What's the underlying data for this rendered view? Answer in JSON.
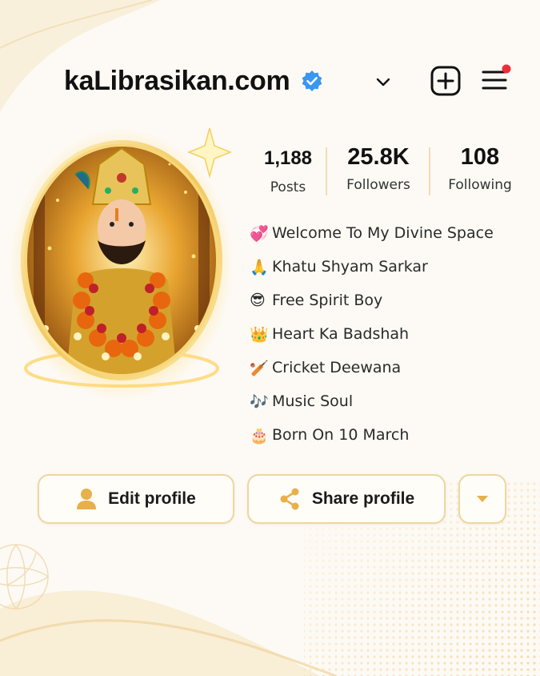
{
  "header": {
    "username": "kaLibrasikan.com",
    "verified": true,
    "icons": [
      "verified-badge-icon",
      "chevron-down-icon",
      "add-post-icon",
      "menu-icon"
    ]
  },
  "stats": [
    {
      "value": "1,188",
      "label": "Posts"
    },
    {
      "value": "25.8K",
      "label": "Followers"
    },
    {
      "value": "108",
      "label": "Following"
    }
  ],
  "bio": [
    {
      "emoji": "💞",
      "text": "Welcome To My Divine Space"
    },
    {
      "emoji": "🙏",
      "text": "Khatu Shyam Sarkar"
    },
    {
      "emoji": "😎",
      "text": "Free Spirit Boy"
    },
    {
      "emoji": "👑",
      "text": "Heart Ka Badshah"
    },
    {
      "emoji": "🏏",
      "text": "Cricket Deewana"
    },
    {
      "emoji": "🎶",
      "text": "Music Soul"
    },
    {
      "emoji": "🎂",
      "text": "Born On 10 March"
    }
  ],
  "actions": {
    "edit_label": "Edit profile",
    "share_label": "Share profile"
  },
  "colors": {
    "accent_gold": "#e8b04a",
    "verified_blue": "#3897f0",
    "notification_red": "#ed2e3a",
    "button_border": "#ecd6a3"
  }
}
